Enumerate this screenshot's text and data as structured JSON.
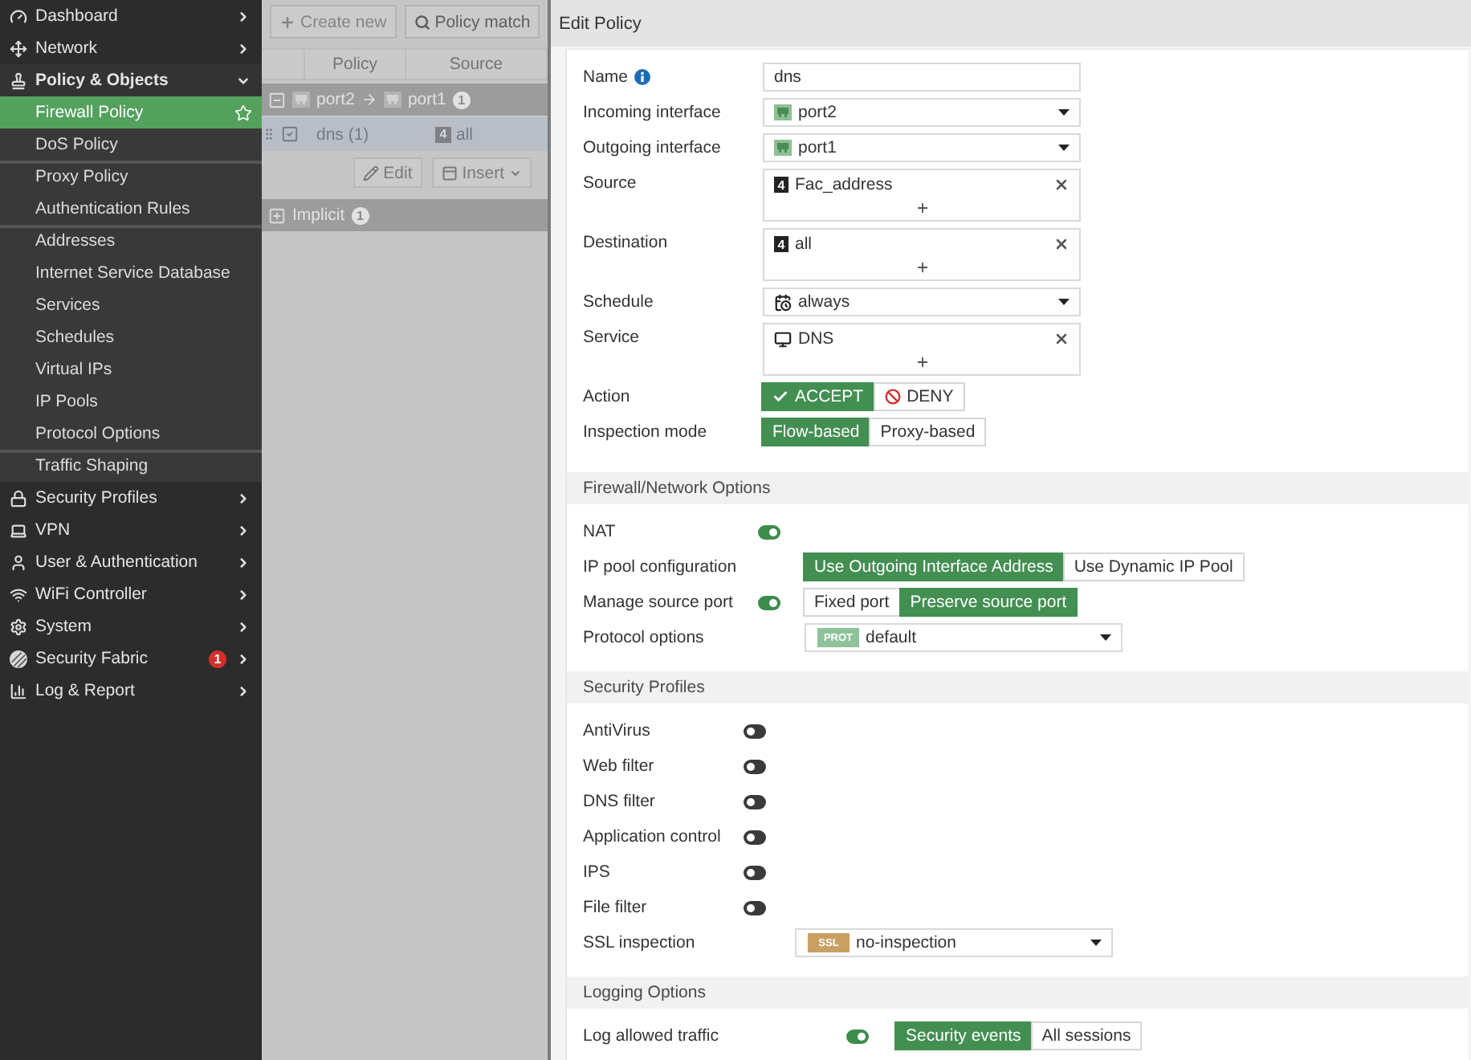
{
  "sidebar": {
    "items": [
      {
        "label": "Dashboard",
        "expanded": false
      },
      {
        "label": "Network",
        "expanded": false
      },
      {
        "label": "Policy & Objects",
        "expanded": true,
        "groups": [
          {
            "children": [
              {
                "label": "Firewall Policy",
                "selected": true
              },
              {
                "label": "DoS Policy",
                "selected": false
              }
            ]
          },
          {
            "children": [
              {
                "label": "Proxy Policy",
                "selected": false
              },
              {
                "label": "Authentication Rules",
                "selected": false
              }
            ]
          },
          {
            "children": [
              {
                "label": "Addresses",
                "selected": false
              },
              {
                "label": "Internet Service Database",
                "selected": false
              },
              {
                "label": "Services",
                "selected": false
              },
              {
                "label": "Schedules",
                "selected": false
              },
              {
                "label": "Virtual IPs",
                "selected": false
              },
              {
                "label": "IP Pools",
                "selected": false
              },
              {
                "label": "Protocol Options",
                "selected": false
              }
            ]
          },
          {
            "children": [
              {
                "label": "Traffic Shaping",
                "selected": false
              }
            ]
          }
        ]
      },
      {
        "label": "Security Profiles",
        "expanded": false
      },
      {
        "label": "VPN",
        "expanded": false
      },
      {
        "label": "User & Authentication",
        "expanded": false
      },
      {
        "label": "WiFi Controller",
        "expanded": false
      },
      {
        "label": "System",
        "expanded": false
      },
      {
        "label": "Security Fabric",
        "expanded": false,
        "badge": "1"
      },
      {
        "label": "Log & Report",
        "expanded": false
      }
    ]
  },
  "policy_list": {
    "toolbar": [
      {
        "label": "Create new",
        "disabled": true
      },
      {
        "label": "Policy match",
        "disabled": false
      }
    ],
    "columns": [
      "Policy",
      "Source"
    ],
    "groups": [
      {
        "kind": "pair",
        "from": "port2",
        "to": "port1",
        "count": "1",
        "expanded": true,
        "rows": [
          {
            "name": "dns (1)",
            "source_badge": "4",
            "source": "all",
            "checked": true
          }
        ],
        "row_actions": [
          "Edit",
          "Insert"
        ]
      },
      {
        "kind": "label",
        "label": "Implicit",
        "count": "1",
        "expanded": false
      }
    ]
  },
  "edit_policy": {
    "title": "Edit Policy",
    "fields": [
      {
        "kind": "text",
        "label": "Name",
        "info": true,
        "value": "dns"
      },
      {
        "kind": "interface",
        "label": "Incoming interface",
        "value": "port2"
      },
      {
        "kind": "interface",
        "label": "Outgoing interface",
        "value": "port1"
      },
      {
        "kind": "addresses",
        "label": "Source",
        "entries": [
          {
            "badge": "4",
            "value": "Fac_address"
          }
        ]
      },
      {
        "kind": "addresses",
        "label": "Destination",
        "entries": [
          {
            "badge": "4",
            "value": "all"
          }
        ]
      },
      {
        "kind": "schedule",
        "label": "Schedule",
        "value": "always"
      },
      {
        "kind": "services",
        "label": "Service",
        "entries": [
          {
            "value": "DNS"
          }
        ]
      },
      {
        "kind": "action",
        "label": "Action",
        "options": [
          {
            "label": "ACCEPT",
            "selected": true
          },
          {
            "label": "DENY",
            "selected": false
          }
        ]
      },
      {
        "kind": "choice",
        "label": "Inspection mode",
        "options": [
          {
            "label": "Flow-based",
            "selected": true
          },
          {
            "label": "Proxy-based",
            "selected": false
          }
        ]
      }
    ],
    "sections": [
      {
        "title": "Firewall/Network Options",
        "fields": [
          {
            "kind": "toggle",
            "label": "NAT",
            "on": true
          },
          {
            "kind": "choice",
            "label": "IP pool configuration",
            "options": [
              {
                "label": "Use Outgoing Interface Address",
                "selected": true
              },
              {
                "label": "Use Dynamic IP Pool",
                "selected": false
              }
            ]
          },
          {
            "kind": "toggle",
            "label": "Manage source port",
            "on": true,
            "options": [
              {
                "label": "Fixed port",
                "selected": false
              },
              {
                "label": "Preserve source port",
                "selected": true
              }
            ]
          },
          {
            "kind": "profile",
            "label": "Protocol options",
            "tag": "PROT",
            "color": "#8fc39a",
            "value": "default"
          }
        ]
      },
      {
        "title": "Security Profiles",
        "fields": [
          {
            "kind": "toggle",
            "label": "AntiVirus",
            "on": false
          },
          {
            "kind": "toggle",
            "label": "Web filter",
            "on": false
          },
          {
            "kind": "toggle",
            "label": "DNS filter",
            "on": false
          },
          {
            "kind": "toggle",
            "label": "Application control",
            "on": false
          },
          {
            "kind": "toggle",
            "label": "IPS",
            "on": false
          },
          {
            "kind": "toggle",
            "label": "File filter",
            "on": false
          },
          {
            "kind": "profile",
            "label": "SSL inspection",
            "tag": "SSL",
            "color": "#c9a064",
            "value": "no-inspection"
          }
        ]
      },
      {
        "title": "Logging Options",
        "fields": [
          {
            "kind": "toggle",
            "label": "Log allowed traffic",
            "on": true,
            "options": [
              {
                "label": "Security events",
                "selected": true
              },
              {
                "label": "All sessions",
                "selected": false
              }
            ]
          }
        ]
      }
    ]
  }
}
